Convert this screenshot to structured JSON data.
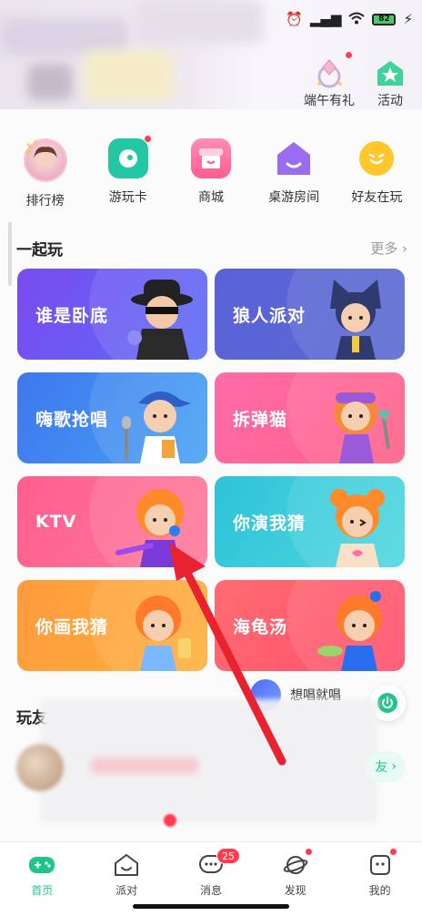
{
  "status_bar": {
    "battery": "82"
  },
  "top_actions": [
    {
      "label": "端午有礼",
      "icon": "gift-ring-icon"
    },
    {
      "label": "活动",
      "icon": "star-house-icon"
    }
  ],
  "quick_entries": [
    {
      "label": "排行榜",
      "icon": "ranking-avatar-icon"
    },
    {
      "label": "游玩卡",
      "icon": "play-card-icon"
    },
    {
      "label": "商城",
      "icon": "shop-icon"
    },
    {
      "label": "桌游房间",
      "icon": "boardgame-room-icon"
    },
    {
      "label": "好友在玩",
      "icon": "friends-playing-icon"
    }
  ],
  "section": {
    "title": "一起玩",
    "more": "更多"
  },
  "games": [
    {
      "title": "谁是卧底",
      "color": "#7a4bf0"
    },
    {
      "title": "狼人派对",
      "color": "#5a62d8"
    },
    {
      "title": "嗨歌抢唱",
      "color": "#3e77ef"
    },
    {
      "title": "拆弹猫",
      "color": "#ff6ca8"
    },
    {
      "title": "KTV",
      "color": "#ff5e8e"
    },
    {
      "title": "你演我猜",
      "color": "#2ec3d9"
    },
    {
      "title": "你画我猜",
      "color": "#ff9a3e"
    },
    {
      "title": "海龟汤",
      "color": "#ff6b72"
    }
  ],
  "friends": {
    "title": "玩友",
    "add_label": "友",
    "singing_label": "想唱就唱"
  },
  "tabs": [
    {
      "label": "首页",
      "active": true
    },
    {
      "label": "派对",
      "active": false
    },
    {
      "label": "消息",
      "active": false,
      "badge": "25"
    },
    {
      "label": "发现",
      "active": false
    },
    {
      "label": "我的",
      "active": false
    }
  ],
  "accent_color": "#1fc58a"
}
